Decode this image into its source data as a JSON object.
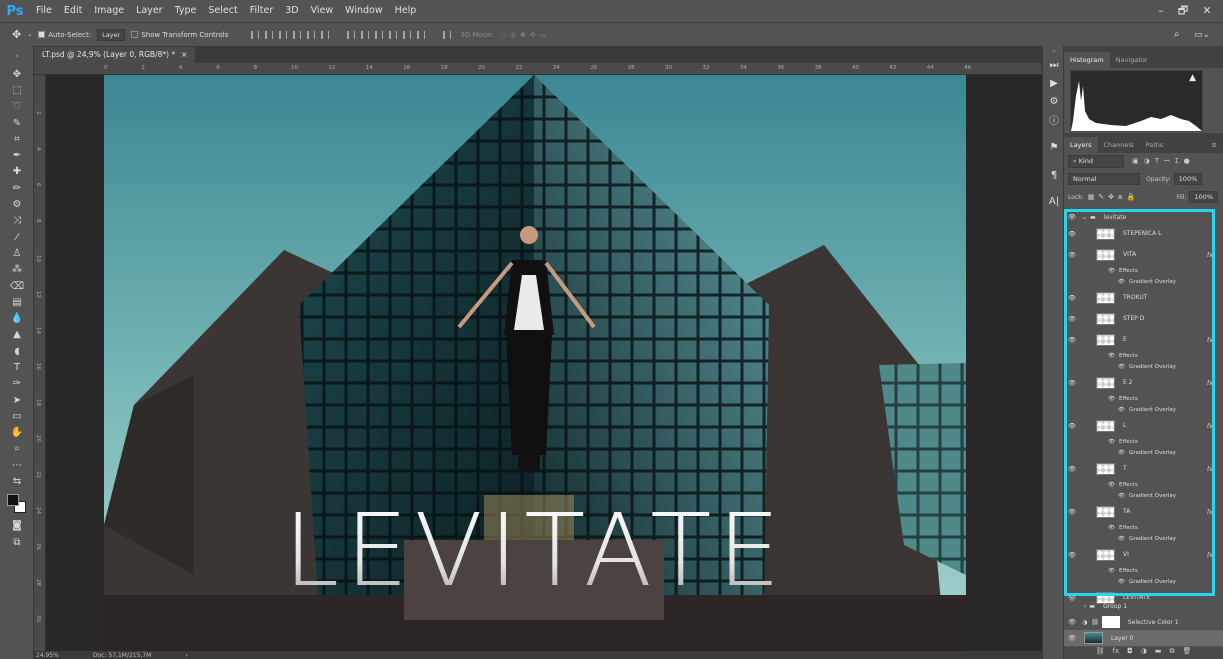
{
  "app": {
    "logo": "Ps"
  },
  "menu": [
    "File",
    "Edit",
    "Image",
    "Layer",
    "Type",
    "Select",
    "Filter",
    "3D",
    "View",
    "Window",
    "Help"
  ],
  "window_controls": {
    "minimize": "–",
    "restore": "🗗",
    "close": "✕"
  },
  "options": {
    "auto_select_label": "Auto-Select:",
    "auto_select_value": "Layer",
    "show_transform_label": "Show Transform Controls",
    "mode_3d_label": "3D Mode:"
  },
  "document_tab": {
    "title": "LT.psd @ 24,9% (Layer 0, RGB/8*) *",
    "close": "×"
  },
  "ruler_h": [
    "0",
    "2",
    "4",
    "6",
    "8",
    "10",
    "12",
    "14",
    "16",
    "18",
    "20",
    "22",
    "24",
    "26",
    "28",
    "30",
    "32",
    "34",
    "36",
    "38",
    "40",
    "42",
    "44",
    "46"
  ],
  "ruler_v": [
    "2",
    "4",
    "6",
    "8",
    "10",
    "12",
    "14",
    "16",
    "18",
    "20",
    "22",
    "24",
    "26",
    "28",
    "30",
    "32"
  ],
  "canvas_text": "LEVITATE",
  "status": {
    "zoom": "24.95%",
    "doc": "Doc: 57,1M/215,7M",
    "arrow": "›"
  },
  "panels": {
    "histogram_tabs": [
      "Histogram",
      "Navigator"
    ],
    "layers_tabs": [
      "Layers",
      "Channels",
      "Paths"
    ],
    "kind_label": "Kind",
    "blend_mode": "Normal",
    "opacity_label": "Opacity:",
    "opacity_value": "100%",
    "lock_label": "Lock:",
    "fill_label": "Fill:",
    "fill_value": "100%",
    "fx_label": "fx",
    "effects_label": "Effects",
    "gradient_overlay_label": "Gradient Overlay",
    "group_levitate": "levitate",
    "layers": [
      {
        "name": "STEPENICA L",
        "fx": false
      },
      {
        "name": "VITA",
        "fx": true
      },
      {
        "name": "TROKUT",
        "fx": false
      },
      {
        "name": "STEP D",
        "fx": false
      },
      {
        "name": "E",
        "fx": true
      },
      {
        "name": "E 2",
        "fx": true
      },
      {
        "name": "L",
        "fx": true
      },
      {
        "name": "T",
        "fx": true
      },
      {
        "name": "TA",
        "fx": true
      },
      {
        "name": "VI",
        "fx": true
      },
      {
        "name": "LEVITATE",
        "fx": false
      }
    ],
    "group_1": "Group 1",
    "selective_color": "Selective Color 1",
    "layer0": "Layer 0"
  },
  "colors": {
    "highlight": "#2ad4ec",
    "ps_blue": "#31a8ff"
  }
}
